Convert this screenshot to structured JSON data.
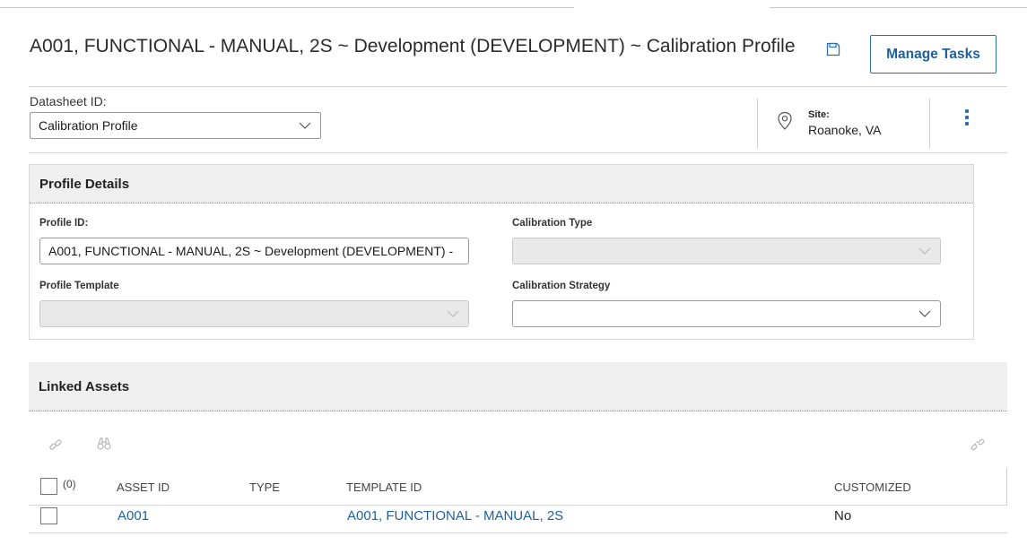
{
  "page": {
    "title": "A001, FUNCTIONAL - MANUAL, 2S ~ Development (DEVELOPMENT) ~ Calibration Profile",
    "manage_tasks_label": "Manage Tasks"
  },
  "datasheet": {
    "label": "Datasheet ID:",
    "selected": "Calibration Profile"
  },
  "site": {
    "label": "Site:",
    "value": "Roanoke, VA"
  },
  "profile_details": {
    "heading": "Profile Details",
    "profile_id_label": "Profile ID:",
    "profile_id_value": "A001, FUNCTIONAL - MANUAL, 2S ~ Development (DEVELOPMENT) -",
    "calibration_type_label": "Calibration Type",
    "calibration_type_value": "",
    "profile_template_label": "Profile Template",
    "profile_template_value": "",
    "calibration_strategy_label": "Calibration Strategy",
    "calibration_strategy_value": ""
  },
  "linked_assets": {
    "heading": "Linked Assets",
    "select_count": "(0)",
    "columns": {
      "asset_id": "ASSET ID",
      "type": "TYPE",
      "template_id": "TEMPLATE ID",
      "customized": "CUSTOMIZED"
    },
    "rows": [
      {
        "asset_id": "A001",
        "type": "",
        "template_id": "A001, FUNCTIONAL - MANUAL, 2S",
        "customized": "No"
      }
    ]
  },
  "colors": {
    "accent": "#1f5f9e",
    "header_bg": "#efefef",
    "disabled_bg": "#e9e9e9"
  },
  "icons": [
    "save-icon",
    "map-pin-icon",
    "more-vertical-icon",
    "link-icon",
    "binoculars-icon",
    "unlink-icon",
    "chevron-down-icon"
  ]
}
